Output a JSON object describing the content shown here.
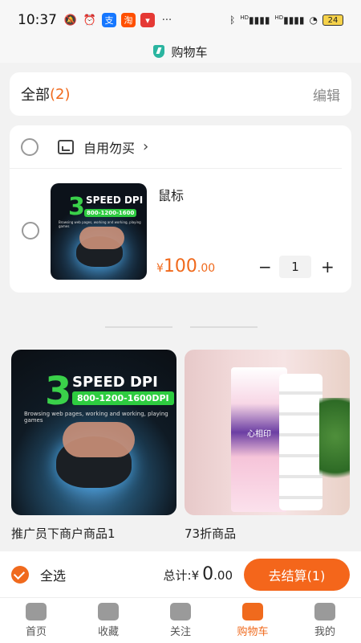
{
  "status_bar": {
    "time": "10:37",
    "icons": [
      "mute-bell-icon",
      "alarm-icon",
      "alipay-app-icon",
      "taobao-app-icon",
      "app-notification-icon",
      "more-dots-icon"
    ],
    "alipay_label": "支",
    "taobao_label": "淘",
    "more": "···",
    "right_icons": [
      "bluetooth-icon",
      "signal-hd-icon",
      "signal-hd-icon-2",
      "wifi-icon"
    ],
    "hd1": "HD",
    "hd2": "HD",
    "battery": "24"
  },
  "header": {
    "title": "购物车"
  },
  "cart": {
    "all_label": "全部",
    "count_open": "(",
    "count": "2",
    "count_close": ")",
    "edit_label": "编辑",
    "shop_name": "自用勿买",
    "chevron": "›",
    "item": {
      "name": "鼠标",
      "currency": "¥",
      "price_int": "100",
      "price_dec": ".00",
      "qty": "1",
      "minus": "−",
      "plus": "+"
    }
  },
  "thumb_art": {
    "big": "3",
    "speed": "SPEED DPI",
    "band": "800-1200-1600",
    "sub": "Browsing web pages, working and working, playing games"
  },
  "recommendations": [
    {
      "title": "推广员下商户商品1"
    },
    {
      "title": "73折商品"
    }
  ],
  "rec_art": {
    "big": "3",
    "speed": "SPEED DPI",
    "band": "800-1200-1600DPI",
    "sub": "Browsing web pages, working and working, playing games",
    "tissue_label": "心相印"
  },
  "checkout": {
    "select_all": "全选",
    "total_label": "总计:",
    "currency": "¥",
    "total_int": "0",
    "total_dec": ".00",
    "pay_button": "去结算(1)"
  },
  "tabbar": [
    {
      "label": "首页",
      "icon": "home-icon"
    },
    {
      "label": "收藏",
      "icon": "favorites-icon"
    },
    {
      "label": "关注",
      "icon": "follow-icon"
    },
    {
      "label": "购物车",
      "icon": "cart-icon",
      "active": true
    },
    {
      "label": "我的",
      "icon": "profile-icon"
    }
  ],
  "colors": {
    "accent": "#f06a1d",
    "checkout_button": "#f4661b",
    "header_shield": "#2bb5a0"
  }
}
